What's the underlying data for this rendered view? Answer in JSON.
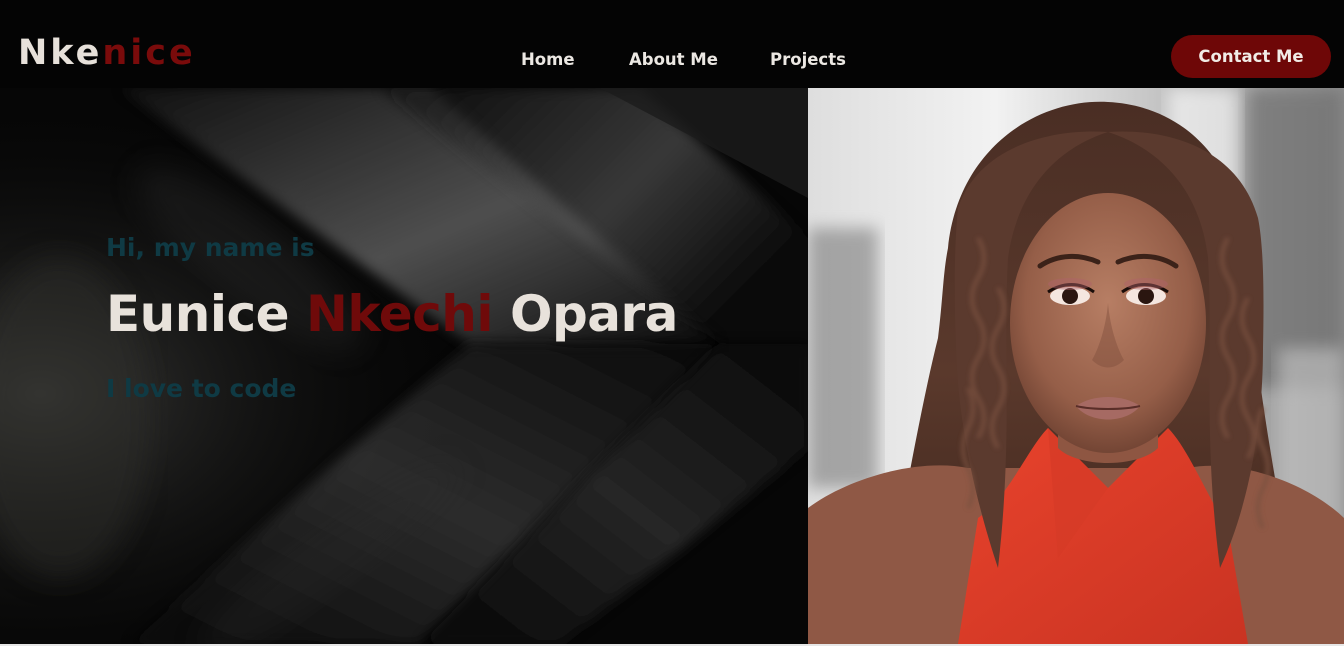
{
  "brand": {
    "logo_part1": "Nke",
    "logo_part2": "nice"
  },
  "nav": {
    "links": [
      "Home",
      "About Me",
      "Projects"
    ],
    "contact_label": "Contact Me"
  },
  "hero": {
    "greeting": "Hi, my name is",
    "name_first": "Eunice",
    "name_middle": "Nkechi",
    "name_last": "Opara",
    "tagline": "I love to code"
  },
  "colors": {
    "background": "#000000",
    "accent_red": "#6e0707",
    "text_light": "#e8e2db",
    "text_teal": "#0f3a44"
  }
}
